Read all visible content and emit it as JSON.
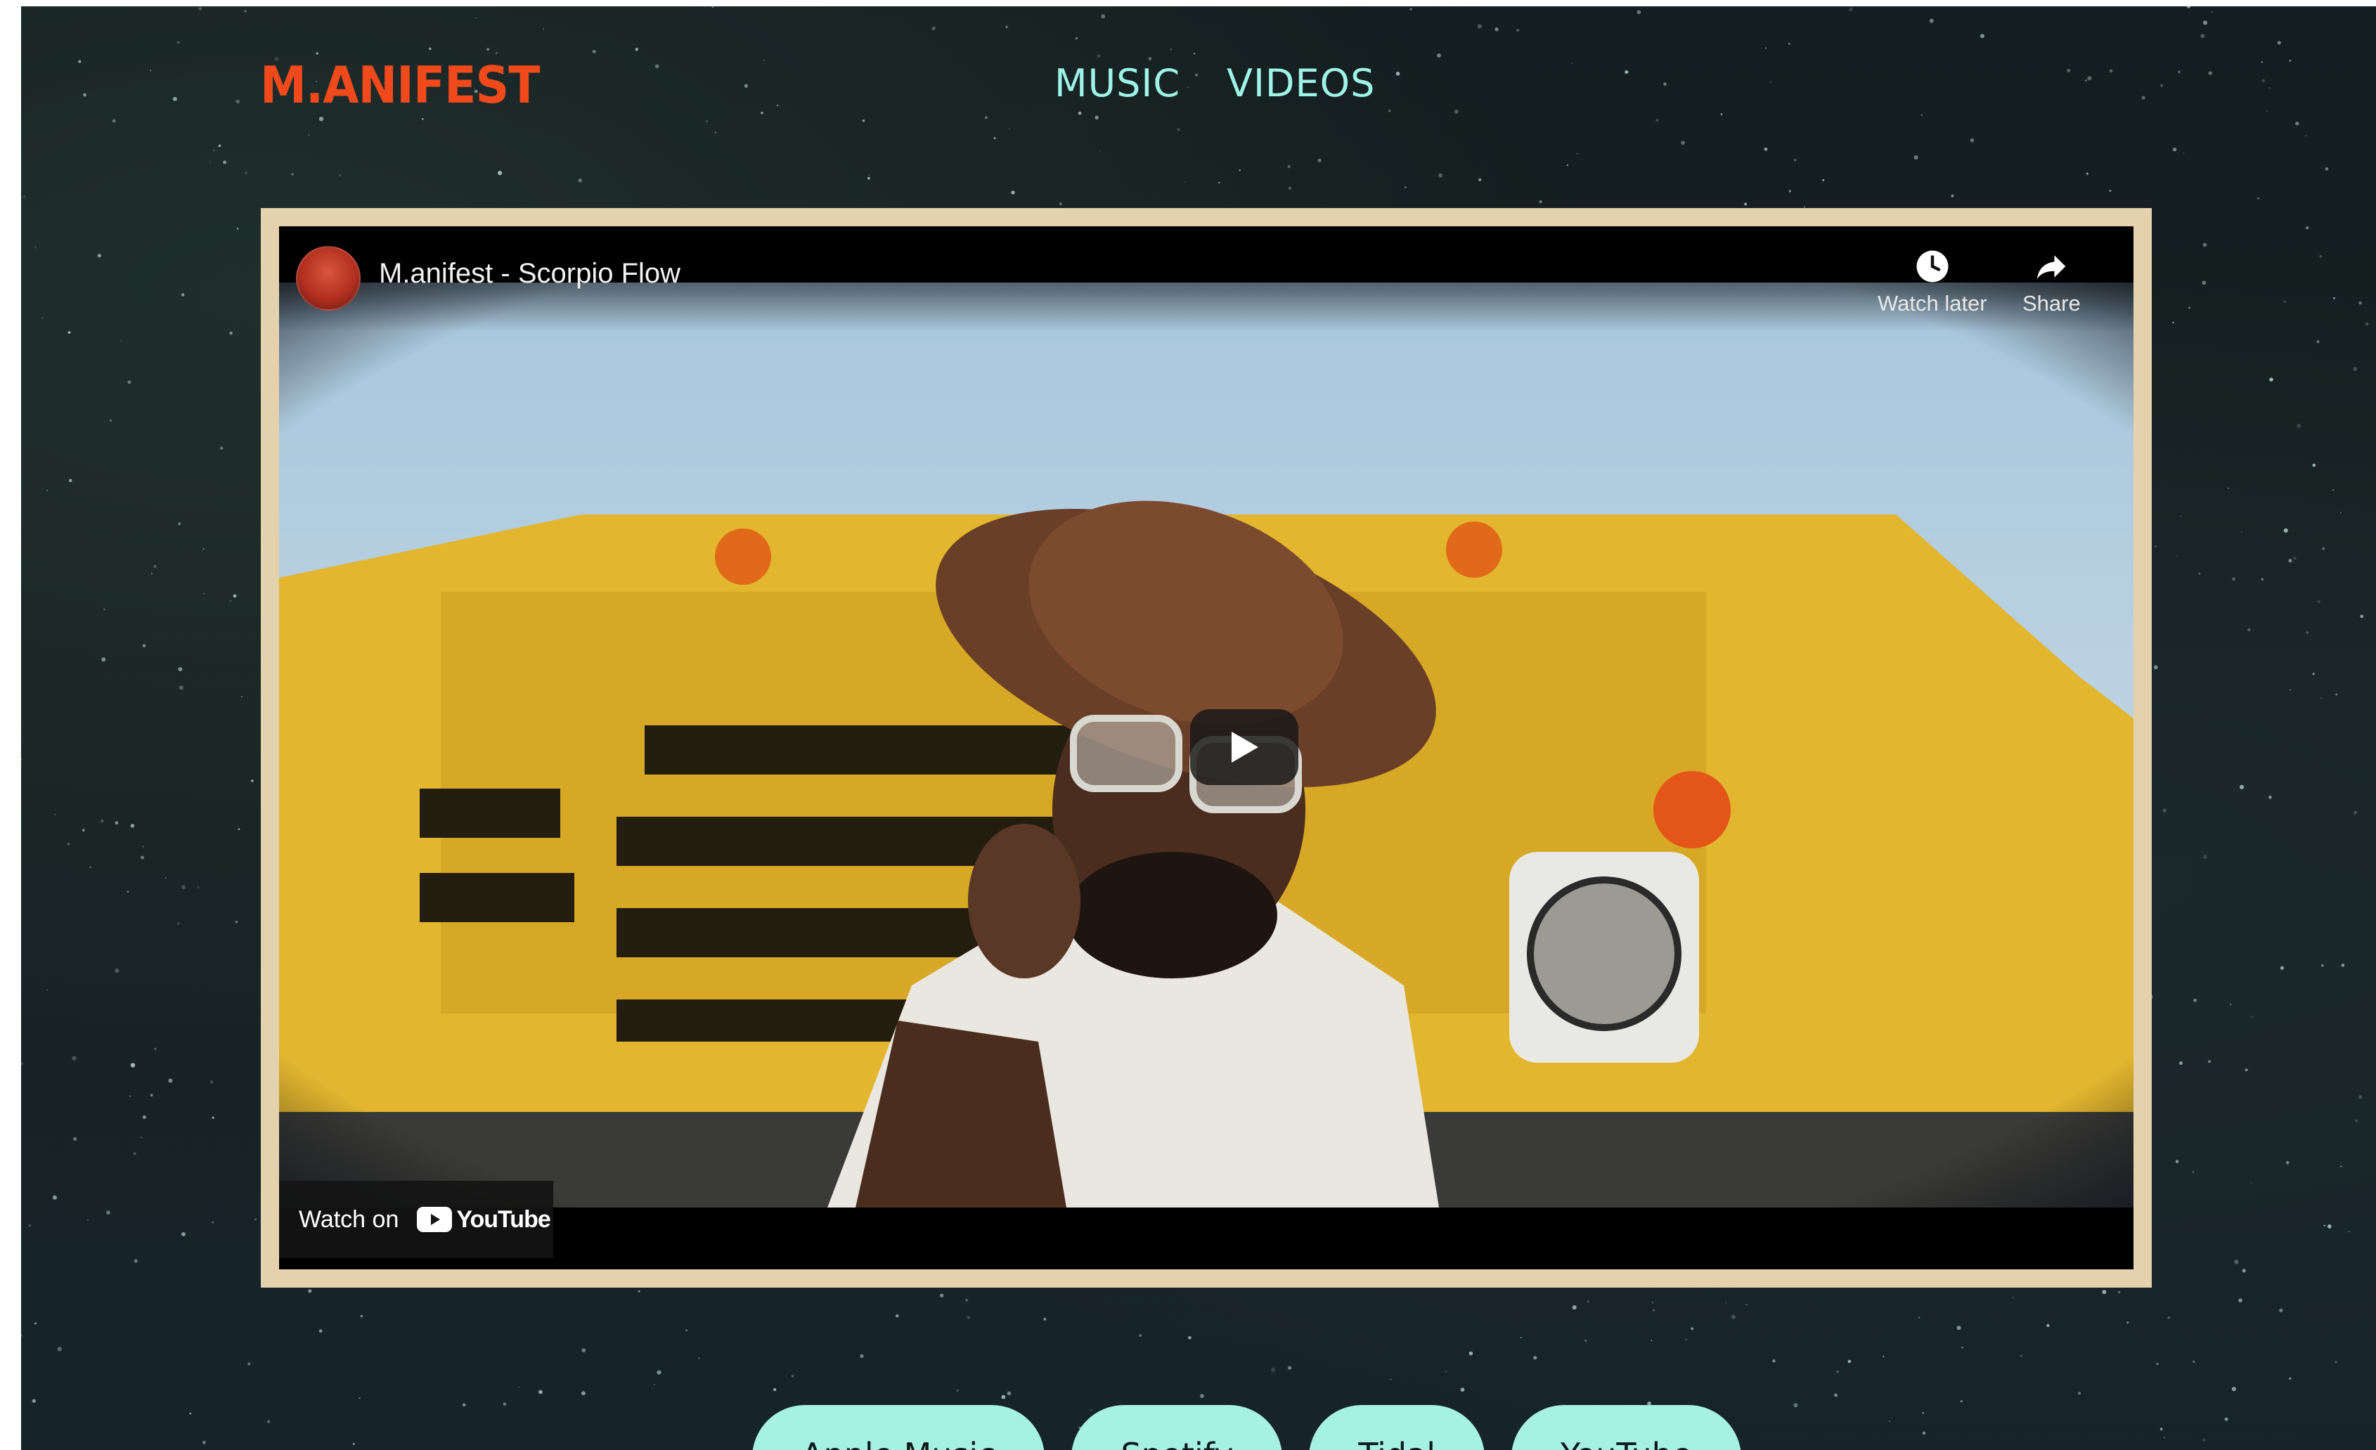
{
  "brand": {
    "logo_text": "M.ANIFEST",
    "logo_color": "#f04a1c"
  },
  "nav": {
    "items": [
      "MUSIC",
      "VIDEOS"
    ],
    "color": "#9ef2e6"
  },
  "video": {
    "title": "M.anifest - Scorpio Flow",
    "actions": {
      "watch_later": "Watch later",
      "share": "Share"
    },
    "watch_on_label": "Watch on",
    "platform_logo": "YouTube",
    "frame_color": "#e4d1ad"
  },
  "streaming": {
    "buttons": [
      "Apple Music",
      "Spotify",
      "Tidal",
      "YouTube"
    ],
    "button_color": "#a6f0e4"
  }
}
